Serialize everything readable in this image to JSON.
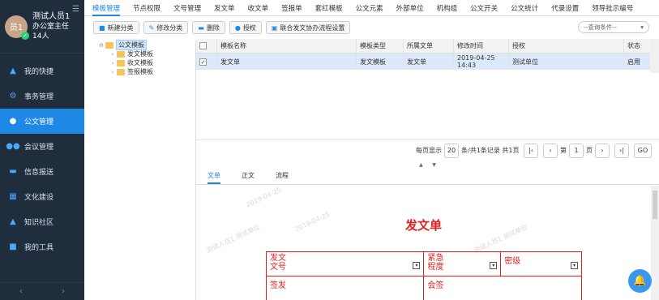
{
  "user": {
    "avatar_text": "员1",
    "name": "测试人员1",
    "role": "办公室主任",
    "count": "14人",
    "menu_icon": "list-icon"
  },
  "nav": [
    {
      "label": "我的快捷",
      "icon": "navigation-icon"
    },
    {
      "label": "事务管理",
      "icon": "tasks-icon"
    },
    {
      "label": "公文管理",
      "icon": "user-icon"
    },
    {
      "label": "会议管理",
      "icon": "group-icon"
    },
    {
      "label": "信息报送",
      "icon": "message-icon"
    },
    {
      "label": "文化建设",
      "icon": "building-icon"
    },
    {
      "label": "知识社区",
      "icon": "graduation-icon"
    },
    {
      "label": "我的工具",
      "icon": "briefcase-icon"
    }
  ],
  "top_tabs": [
    "模板管理",
    "节点权限",
    "文号管理",
    "发文单",
    "收文单",
    "签报单",
    "套红模板",
    "公文元素",
    "外部单位",
    "机构组",
    "公文开关",
    "公文统计",
    "代录设置",
    "领导批示编号"
  ],
  "toolbar": {
    "new": "新建分类",
    "edit": "修改分类",
    "delete": "删除",
    "auth": "授权",
    "flow": "联合发文协办流程设置",
    "search_placeholder": "--查询条件--"
  },
  "tree": {
    "root": "公文模板",
    "children": [
      "发文模板",
      "收文模板",
      "签报模板"
    ]
  },
  "grid": {
    "headers": [
      "模板名称",
      "模板类型",
      "所属文单",
      "修改时间",
      "授权",
      "状态"
    ],
    "rows": [
      {
        "name": "发文单",
        "type": "发文模板",
        "form": "发文单",
        "time": "2019-04-25 14:43",
        "auth": "测试单位",
        "status": "启用"
      }
    ]
  },
  "pager": {
    "per_page_label": "每页显示",
    "per_page": "20",
    "total": "条/共1条记录",
    "pages": "共1页",
    "page_prefix": "第",
    "page": "1",
    "page_suffix": "页",
    "go": "GO"
  },
  "doc_tabs": [
    "文单",
    "正文",
    "流程"
  ],
  "doc": {
    "title": "发文单",
    "watermarks": [
      "2019-04-25",
      "测试人员1 测试单位",
      "2019-04-25",
      "测试人员1 测试单位"
    ],
    "fields": {
      "doc_no": "发文\n文号",
      "urgency": "紧急\n程度",
      "secret": "密级",
      "sign": "签发",
      "countersign": "会签"
    }
  }
}
